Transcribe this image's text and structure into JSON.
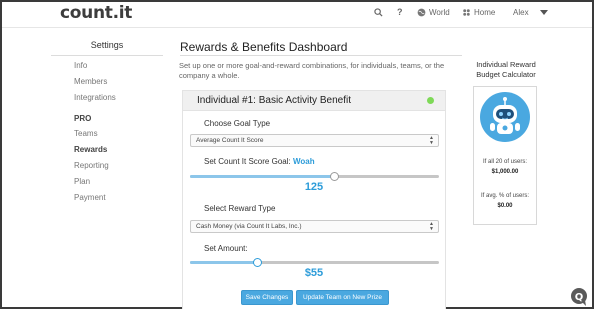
{
  "brand": "count.it",
  "nav": {
    "world_label": "World",
    "home_label": "Home",
    "user_label": "Alex"
  },
  "sidebar": {
    "title": "Settings",
    "items": [
      {
        "label": "Info",
        "active": false
      },
      {
        "label": "Members",
        "active": false
      },
      {
        "label": "Integrations",
        "active": false
      },
      {
        "label": "PRO",
        "active": false,
        "heading": true
      },
      {
        "label": "Teams",
        "active": false
      },
      {
        "label": "Rewards",
        "active": true
      },
      {
        "label": "Reporting",
        "active": false
      },
      {
        "label": "Plan",
        "active": false
      },
      {
        "label": "Payment",
        "active": false
      }
    ]
  },
  "main": {
    "title": "Rewards & Benefits Dashboard",
    "description": "Set up one or more goal-and-reward combinations, for individuals, teams, or the company a whole."
  },
  "card": {
    "title": "Individual #1: Basic Activity Benefit",
    "status_color": "#7ed957",
    "goal_type_label": "Choose Goal Type",
    "goal_type_value": "Average Count It Score",
    "score_goal_label": "Set Count It Score Goal:",
    "score_goal_word": "Woah",
    "score_goal_value": "125",
    "score_slider_fraction": 0.58,
    "reward_type_label": "Select Reward Type",
    "reward_type_value": "Cash Money (via Count It Labs, Inc.)",
    "amount_label": "Set Amount:",
    "amount_value": "$55",
    "amount_slider_fraction": 0.27,
    "save_button": "Save Changes",
    "update_button": "Update Team on New Prize"
  },
  "calculator": {
    "title_line1": "Individual Reward",
    "title_line2": "Budget Calculator",
    "all_users_label": "If all 20 of users:",
    "all_users_value": "$1,000.00",
    "avg_users_label": "If avg. % of users:",
    "avg_users_value": "$0.00"
  },
  "colors": {
    "accent": "#2d9cd9",
    "button": "#4aa8e0",
    "status_green": "#7ed957"
  },
  "icons": [
    "search-icon",
    "help-icon",
    "world-icon",
    "home-icon",
    "chevron-down-icon",
    "robot-icon",
    "chat-help-icon"
  ]
}
